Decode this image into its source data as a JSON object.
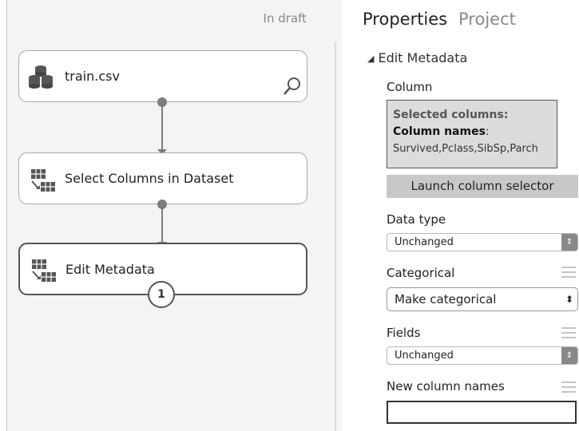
{
  "canvas": {
    "status": "In draft",
    "modules": [
      {
        "label": "train.csv"
      },
      {
        "label": "Select Columns in Dataset"
      },
      {
        "label": "Edit Metadata",
        "badge": "1"
      }
    ]
  },
  "panel": {
    "tabs": [
      {
        "label": "Properties",
        "active": true
      },
      {
        "label": "Project",
        "active": false
      }
    ],
    "section": "Edit Metadata",
    "column": {
      "label": "Column",
      "selected_title": "Selected columns:",
      "names_label": "Column names",
      "names_sep": ":",
      "names_value": "Survived,Pclass,SibSp,Parch",
      "launch_button": "Launch column selector"
    },
    "data_type": {
      "label": "Data type",
      "value": "Unchanged"
    },
    "categorical": {
      "label": "Categorical",
      "value": "Make categorical"
    },
    "fields": {
      "label": "Fields",
      "value": "Unchanged"
    },
    "new_column_names": {
      "label": "New column names",
      "value": ""
    }
  },
  "colors": {
    "canvas_bg": "#f4f4f4",
    "module_border": "#a9a9a9",
    "connector": "#7d7d7d",
    "button_bg": "#c8c8c8",
    "selected_box_bg": "#dcdcdc"
  },
  "icons": [
    "dataset-icon",
    "magnify-icon",
    "module-grid-icon",
    "triangle-down-icon",
    "drag-handle-icon",
    "select-caret-icon"
  ]
}
